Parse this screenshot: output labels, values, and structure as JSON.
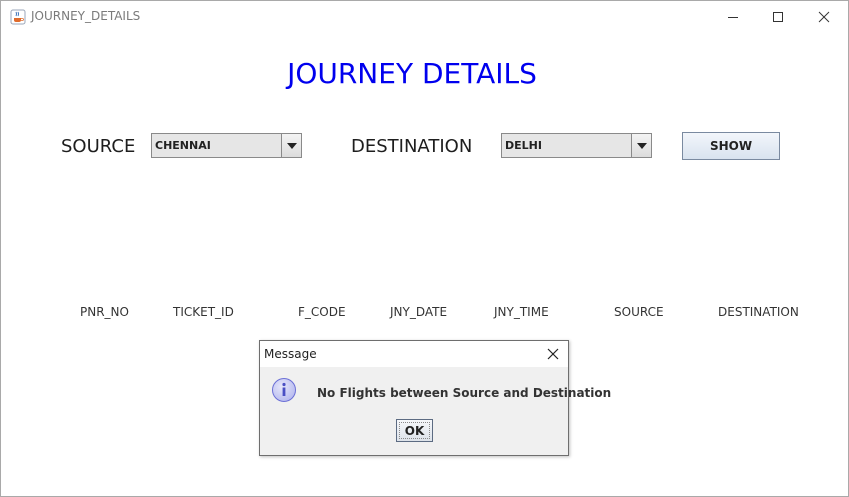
{
  "window": {
    "title": "JOURNEY_DETAILS"
  },
  "heading": "JOURNEY DETAILS",
  "form": {
    "source_label": "SOURCE",
    "source_value": "CHENNAI",
    "destination_label": "DESTINATION",
    "destination_value": "DELHI",
    "show_label": "SHOW"
  },
  "table": {
    "columns": [
      "PNR_NO",
      "TICKET_ID",
      "F_CODE",
      "JNY_DATE",
      "JNY_TIME",
      "SOURCE",
      "DESTINATION"
    ]
  },
  "dialog": {
    "title": "Message",
    "message": "No Flights between Source and Destination",
    "ok_label": "OK"
  },
  "colors": {
    "heading": "#0000ee",
    "info_icon": "#6b6fd6"
  },
  "icons": {
    "app": "java-cup-icon",
    "minimize": "minimize-icon",
    "maximize": "maximize-icon",
    "close": "close-icon",
    "dropdown": "chevron-down-icon",
    "info": "info-icon"
  }
}
